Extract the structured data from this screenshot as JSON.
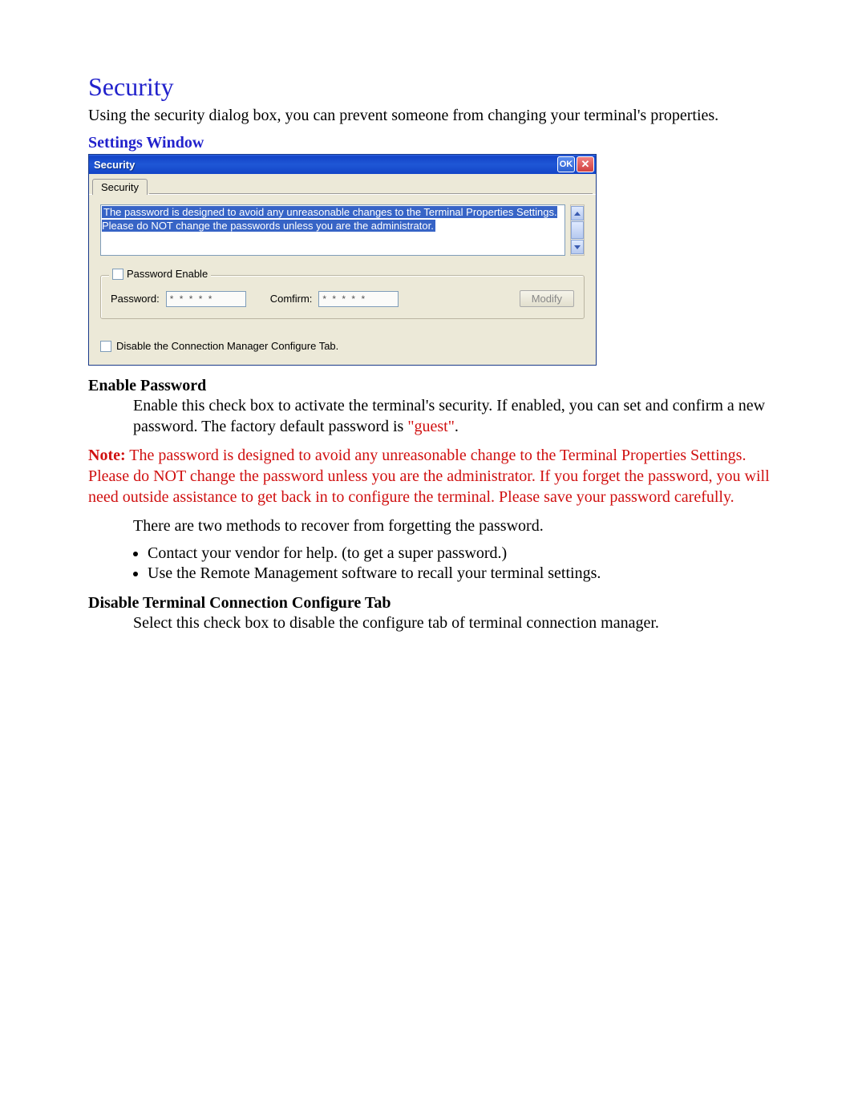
{
  "heading": "Security",
  "intro": "Using the security dialog box, you can prevent someone from changing your terminal's properties.",
  "subhead": "Settings Window",
  "window": {
    "title": "Security",
    "ok_label": "OK",
    "close_label": "✕",
    "tab_label": "Security",
    "message": "The password is designed to avoid any unreasonable changes to the Terminal Properties Settings. Please do NOT change the passwords unless you are the administrator.",
    "group_legend": "Password Enable",
    "password_label": "Password:",
    "password_value": "* * * * *",
    "confirm_label": "Comfirm:",
    "confirm_value": "* * * * *",
    "modify_label": "Modify",
    "disable_label": "Disable the Connection Manager Configure Tab."
  },
  "sections": {
    "enable_title": "Enable Password",
    "enable_text_pre": "Enable this check box to activate the terminal's security.  If enabled, you can set and confirm a new password.  The factory default password is ",
    "enable_default_pw": "\"guest\"",
    "enable_text_post": ".",
    "note_label": "Note:",
    "note_body": "  The password is designed to avoid any unreasonable change to the Terminal Properties Settings.  Please do NOT change the password unless you are the administrator.  If you forget the password, you will need outside assistance to get back in to configure the terminal.  Please save your password carefully.",
    "recover_intro": "There are two methods to recover from forgetting the password.",
    "recover_items": [
      "Contact your vendor for help. (to get a super password.)",
      "Use the Remote Management software to recall your terminal settings."
    ],
    "disable_title": "Disable Terminal Connection Configure Tab",
    "disable_text": "Select this check box to disable the configure tab of terminal connection manager."
  }
}
